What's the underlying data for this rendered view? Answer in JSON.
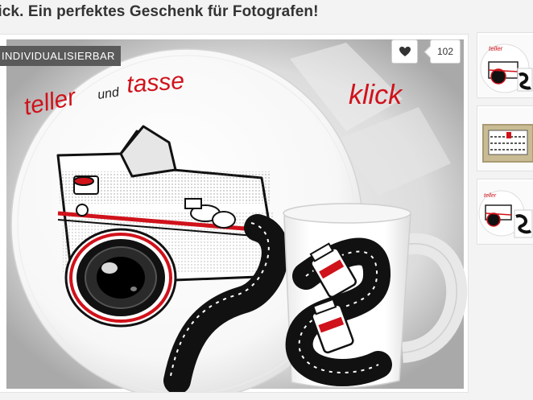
{
  "header": {
    "title": "lick. Ein perfektes Geschenk für Fotografen!"
  },
  "product": {
    "badge": "INDIVIDUALISIERBAR",
    "like_icon": "heart-icon",
    "like_count": "102",
    "plate_text_1": "teller",
    "plate_text_2": "und",
    "plate_text_3": "tasse",
    "klick_text": "klick"
  },
  "thumbnails": [
    {
      "name": "thumbnail-plate-and-mug"
    },
    {
      "name": "thumbnail-gift-box"
    },
    {
      "name": "thumbnail-plate-and-mug-alt"
    }
  ],
  "colors": {
    "accent_red": "#d0121b",
    "badge_bg": "#5a5a5a"
  }
}
